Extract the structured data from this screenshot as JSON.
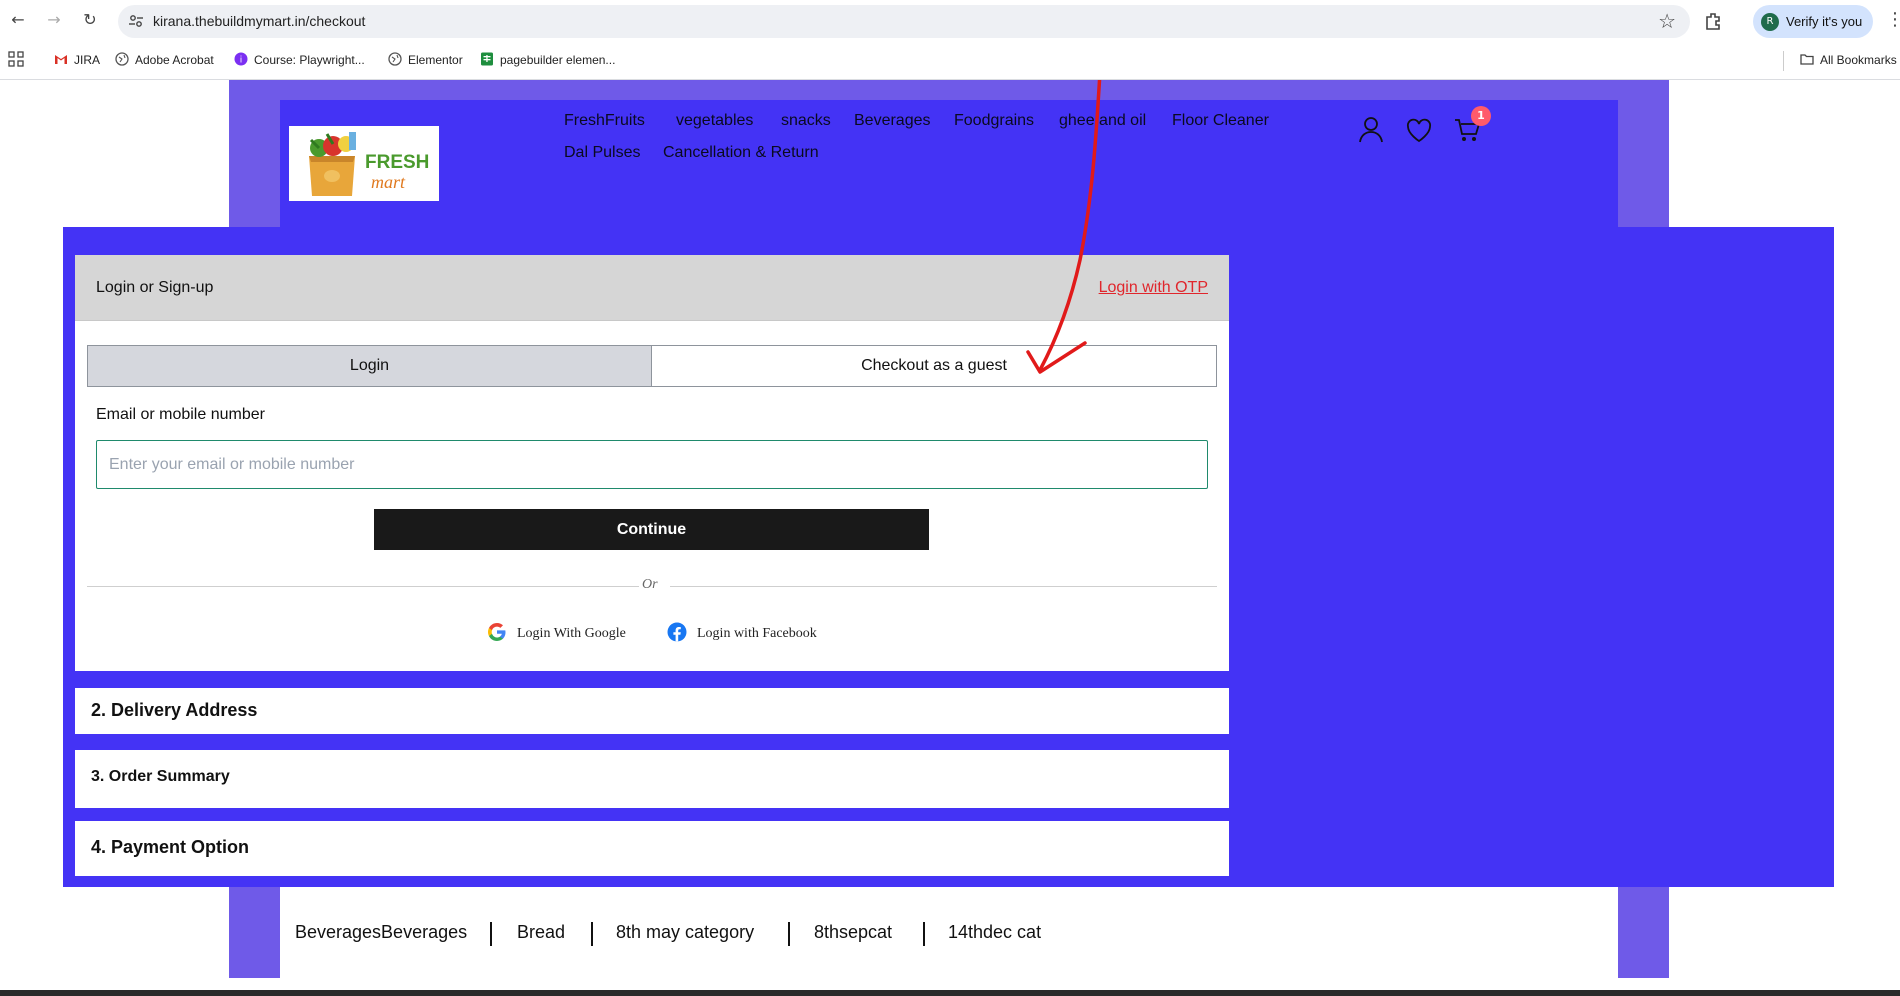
{
  "browser": {
    "url": "kirana.thebuildmymart.in/checkout",
    "verify_label": "Verify it's you",
    "avatar_letter": "R"
  },
  "bookmarks": [
    {
      "label": "JIRA",
      "icon": "gmail-icon"
    },
    {
      "label": "Adobe Acrobat",
      "icon": "globe-icon"
    },
    {
      "label": "Course: Playwright...",
      "icon": "course-icon"
    },
    {
      "label": "Elementor",
      "icon": "globe-icon"
    },
    {
      "label": "pagebuilder elemen...",
      "icon": "sheets-icon"
    },
    {
      "label": "All Bookmarks",
      "icon": "folder-icon"
    }
  ],
  "header": {
    "logo": {
      "line1": "FRESH",
      "line2": "mart"
    },
    "nav_row1": [
      "FreshFruits",
      "vegetables",
      "snacks",
      "Beverages",
      "Foodgrains",
      "ghee and oil",
      "Floor Cleaner"
    ],
    "nav_row2": [
      "Dal Pulses",
      "Cancellation & Return"
    ],
    "cart_count": "1"
  },
  "login": {
    "title": "Login or Sign-up",
    "otp_link": "Login with OTP",
    "tabs": [
      "Login",
      "Checkout as a guest"
    ],
    "email_label": "Email or mobile number",
    "email_placeholder": "Enter your email or mobile number",
    "continue_label": "Continue",
    "or_text": "Or",
    "google_label": "Login With Google",
    "facebook_label": "Login with Facebook"
  },
  "steps": [
    {
      "label": "2. Delivery Address"
    },
    {
      "label": "3. Order Summary"
    },
    {
      "label": "4. Payment Option"
    }
  ],
  "footer_links": [
    "BeveragesBeverages",
    "Bread",
    "8th may category",
    "8thsepcat",
    "14thdec cat"
  ],
  "colors": {
    "brand_blue": "#4433f5",
    "outer_purple": "#6f5ae8",
    "otp_red": "#e0262c",
    "annotation_red": "#e11a1a"
  }
}
